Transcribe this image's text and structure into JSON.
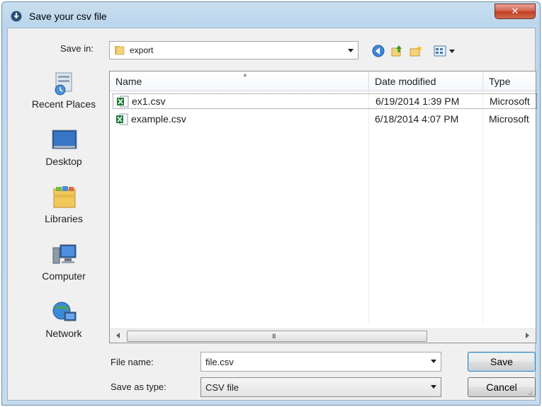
{
  "window": {
    "title": "Save your csv file",
    "close_symbol": "✕"
  },
  "toolbar": {
    "save_in_label": "Save in:",
    "save_in_value": "export",
    "icons": [
      "back-icon",
      "up-folder-icon",
      "new-folder-icon",
      "views-menu-icon"
    ]
  },
  "places": [
    {
      "label": "Recent Places",
      "icon": "recent-places-icon"
    },
    {
      "label": "Desktop",
      "icon": "desktop-icon"
    },
    {
      "label": "Libraries",
      "icon": "libraries-icon"
    },
    {
      "label": "Computer",
      "icon": "computer-icon"
    },
    {
      "label": "Network",
      "icon": "network-icon"
    }
  ],
  "file_list": {
    "columns": [
      "Name",
      "Date modified",
      "Type"
    ],
    "rows": [
      {
        "name": "ex1.csv",
        "date": "6/19/2014 1:39 PM",
        "type": "Microsoft"
      },
      {
        "name": "example.csv",
        "date": "6/18/2014 4:07 PM",
        "type": "Microsoft"
      }
    ],
    "scroll_grip": "III"
  },
  "form": {
    "file_name_label": "File name:",
    "file_name_value": "file.csv",
    "save_as_type_label": "Save as type:",
    "save_as_type_value": "CSV file"
  },
  "buttons": {
    "save": "Save",
    "cancel": "Cancel"
  },
  "colors": {
    "title_bar": "#bcd6ec",
    "close_button": "#c13d22",
    "excel_green": "#1f7a3a"
  }
}
